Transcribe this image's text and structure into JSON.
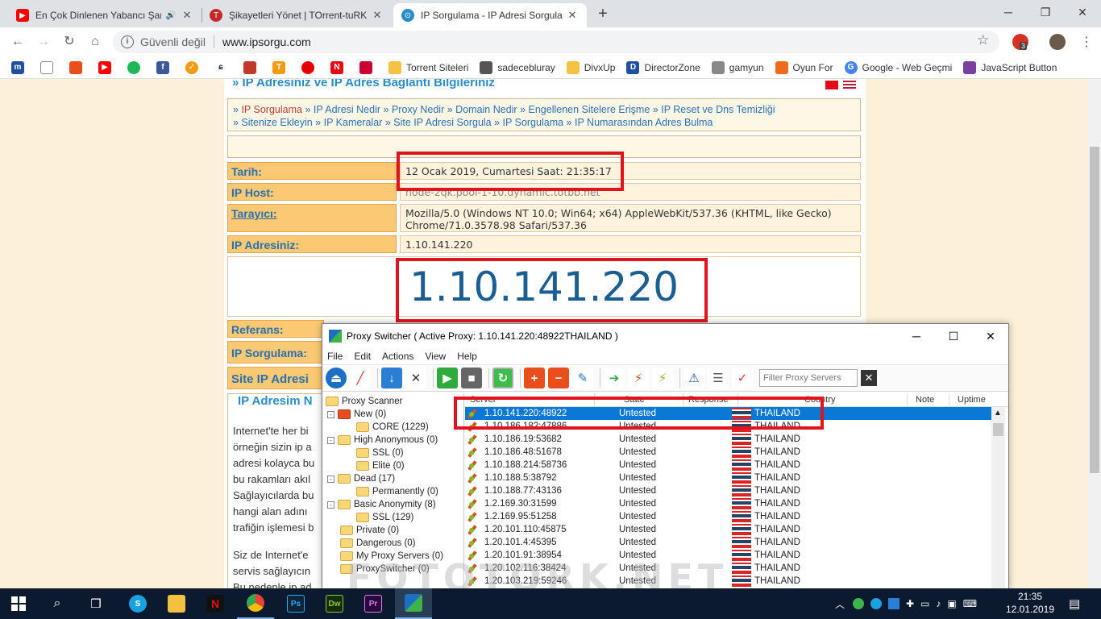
{
  "browser": {
    "tabs": [
      {
        "title": "En Çok Dinlenen Yabancı Şar",
        "icon": "youtube-icon",
        "color": "#ff0000"
      },
      {
        "title": "Şikayetleri Yönet | TOrrent-tuRK",
        "icon": "torrent-turk-icon",
        "color": "#c62828"
      },
      {
        "title": "IP Sorgulama - IP Adresi Sorgula",
        "icon": "ipsorgu-icon",
        "color": "#2a8cc8"
      }
    ],
    "close_glyph": "✕",
    "newtab_glyph": "+",
    "security_text": "Güvenli değil",
    "url": "www.ipsorgu.com",
    "ext_badge": "3",
    "bookmarks": [
      {
        "label": "Torrent Siteleri",
        "color": "#f6c244"
      },
      {
        "label": "sadecebluray",
        "color": "#555"
      },
      {
        "label": "DivxUp",
        "color": "#f6c244"
      },
      {
        "label": "DirectorZone",
        "color": "#1e4fa0"
      },
      {
        "label": "gamyun",
        "color": "#888"
      },
      {
        "label": "Oyun For",
        "color": "#f06a1c"
      },
      {
        "label": "Google - Web Geçmi",
        "color": "#4285f4"
      },
      {
        "label": "JavaScript Button",
        "color": "#7b3fa0"
      }
    ]
  },
  "page": {
    "header": "» IP Adresiniz ve IP Adres Bağlantı Bilgileriniz",
    "links": [
      {
        "text": "IP Sorgulama",
        "active": true
      },
      {
        "text": "IP Adresi Nedir"
      },
      {
        "text": "Proxy Nedir"
      },
      {
        "text": "Domain Nedir"
      },
      {
        "text": "Engellenen Sitelere Erişme"
      },
      {
        "text": "IP Reset ve Dns Temizliği"
      },
      {
        "text": "Sitenize Ekleyin"
      },
      {
        "text": "IP Kameralar"
      },
      {
        "text": "Site IP Adresi Sorgula"
      },
      {
        "text": "IP Sorgulama"
      },
      {
        "text": "IP Numarasından Adres Bulma"
      }
    ],
    "link_prefix": "»",
    "date_label": "Tarih:",
    "date_value": "12 Ocak 2019, Cumartesi Saat: 21:35:17",
    "host_label": "IP Host:",
    "host_value": "node-2qk.pool-1-10.dynamic.totbb.net",
    "browser_label": "Tarayıcı:",
    "browser_value": "Mozilla/5.0 (Windows NT 10.0; Win64; x64) AppleWebKit/537.36 (KHTML, like Gecko) Chrome/71.0.3578.98 Safari/537.36",
    "ip_label": "IP Adresiniz:",
    "ip_value": "1.10.141.220",
    "big_ip": "1.10.141.220",
    "ref_label": "Referans:",
    "sorgu_label": "IP Sorgulama:",
    "site_label": "Site IP Adresi",
    "section_title": "IP Adresim N",
    "body_lines": [
      "Internet'te her bi",
      "örneğin sizin ip a",
      "adresi kolayca bu",
      "bu rakamları akıl",
      "Sağlayıcılarda bu",
      "hangi alan adını",
      "trafiğin işlemesi b"
    ],
    "body2_lines": [
      "Siz de Internet'e",
      "servis sağlayıcın",
      "Bu nedenle ip ad"
    ]
  },
  "proxy_switcher": {
    "title": "Proxy Switcher ( Active Proxy: 1.10.141.220:48922THAILAND )",
    "menu": [
      "File",
      "Edit",
      "Actions",
      "View",
      "Help"
    ],
    "filter_placeholder": "Filter Proxy Servers",
    "tree": [
      {
        "label": "Proxy Scanner",
        "level": 0
      },
      {
        "label": "New (0)",
        "level": 1,
        "expander": "-"
      },
      {
        "label": "CORE (1229)",
        "level": 2
      },
      {
        "label": "High Anonymous (0)",
        "level": 1,
        "expander": "-"
      },
      {
        "label": "SSL (0)",
        "level": 2
      },
      {
        "label": "Elite (0)",
        "level": 2
      },
      {
        "label": "Dead (17)",
        "level": 1,
        "expander": "-"
      },
      {
        "label": "Permanently (0)",
        "level": 2
      },
      {
        "label": "Basic Anonymity (8)",
        "level": 1,
        "expander": "-"
      },
      {
        "label": "SSL (129)",
        "level": 2
      },
      {
        "label": "Private (0)",
        "level": 1
      },
      {
        "label": "Dangerous (0)",
        "level": 1
      },
      {
        "label": "My Proxy Servers (0)",
        "level": 1
      },
      {
        "label": "ProxySwitcher (0)",
        "level": 1
      }
    ],
    "columns": [
      "Server",
      "State",
      "Response",
      "Country",
      "Note",
      "Uptime"
    ],
    "rows": [
      {
        "server": "1.10.141.220:48922",
        "state": "Untested",
        "country": "THAILAND",
        "selected": true
      },
      {
        "server": "1.10.186.182:47886",
        "state": "Untested",
        "country": "THAILAND"
      },
      {
        "server": "1.10.186.19:53682",
        "state": "Untested",
        "country": "THAILAND"
      },
      {
        "server": "1.10.186.48:51678",
        "state": "Untested",
        "country": "THAILAND"
      },
      {
        "server": "1.10.188.214:58736",
        "state": "Untested",
        "country": "THAILAND"
      },
      {
        "server": "1.10.188.5:38792",
        "state": "Untested",
        "country": "THAILAND"
      },
      {
        "server": "1.10.188.77:43136",
        "state": "Untested",
        "country": "THAILAND"
      },
      {
        "server": "1.2.169.30:31599",
        "state": "Untested",
        "country": "THAILAND"
      },
      {
        "server": "1.2.169.95:51258",
        "state": "Untested",
        "country": "THAILAND"
      },
      {
        "server": "1.20.101.110:45875",
        "state": "Untested",
        "country": "THAILAND"
      },
      {
        "server": "1.20.101.4:45395",
        "state": "Untested",
        "country": "THAILAND"
      },
      {
        "server": "1.20.101.91:38954",
        "state": "Untested",
        "country": "THAILAND"
      },
      {
        "server": "1.20.102.116:38424",
        "state": "Untested",
        "country": "THAILAND"
      },
      {
        "server": "1.20.103.219:59246",
        "state": "Untested",
        "country": "THAILAND"
      }
    ]
  },
  "watermark": "FOTOTORK.NET",
  "taskbar": {
    "time": "21:35",
    "date": "12.01.2019",
    "apps": [
      {
        "name": "skype",
        "label": "S",
        "color": "#1aa1e0"
      },
      {
        "name": "explorer",
        "label": "",
        "color": "#f3c140"
      },
      {
        "name": "netflix",
        "label": "N",
        "color": "#e50914"
      },
      {
        "name": "chrome",
        "label": "",
        "color": "#34a853"
      },
      {
        "name": "photoshop",
        "label": "Ps",
        "color": "#0d2538"
      },
      {
        "name": "dreamweaver",
        "label": "Dw",
        "color": "#1a2a0a"
      },
      {
        "name": "premiere",
        "label": "Pr",
        "color": "#2a0a3a"
      },
      {
        "name": "proxyswitcher",
        "label": "",
        "color": "#1b6fc4"
      }
    ]
  }
}
